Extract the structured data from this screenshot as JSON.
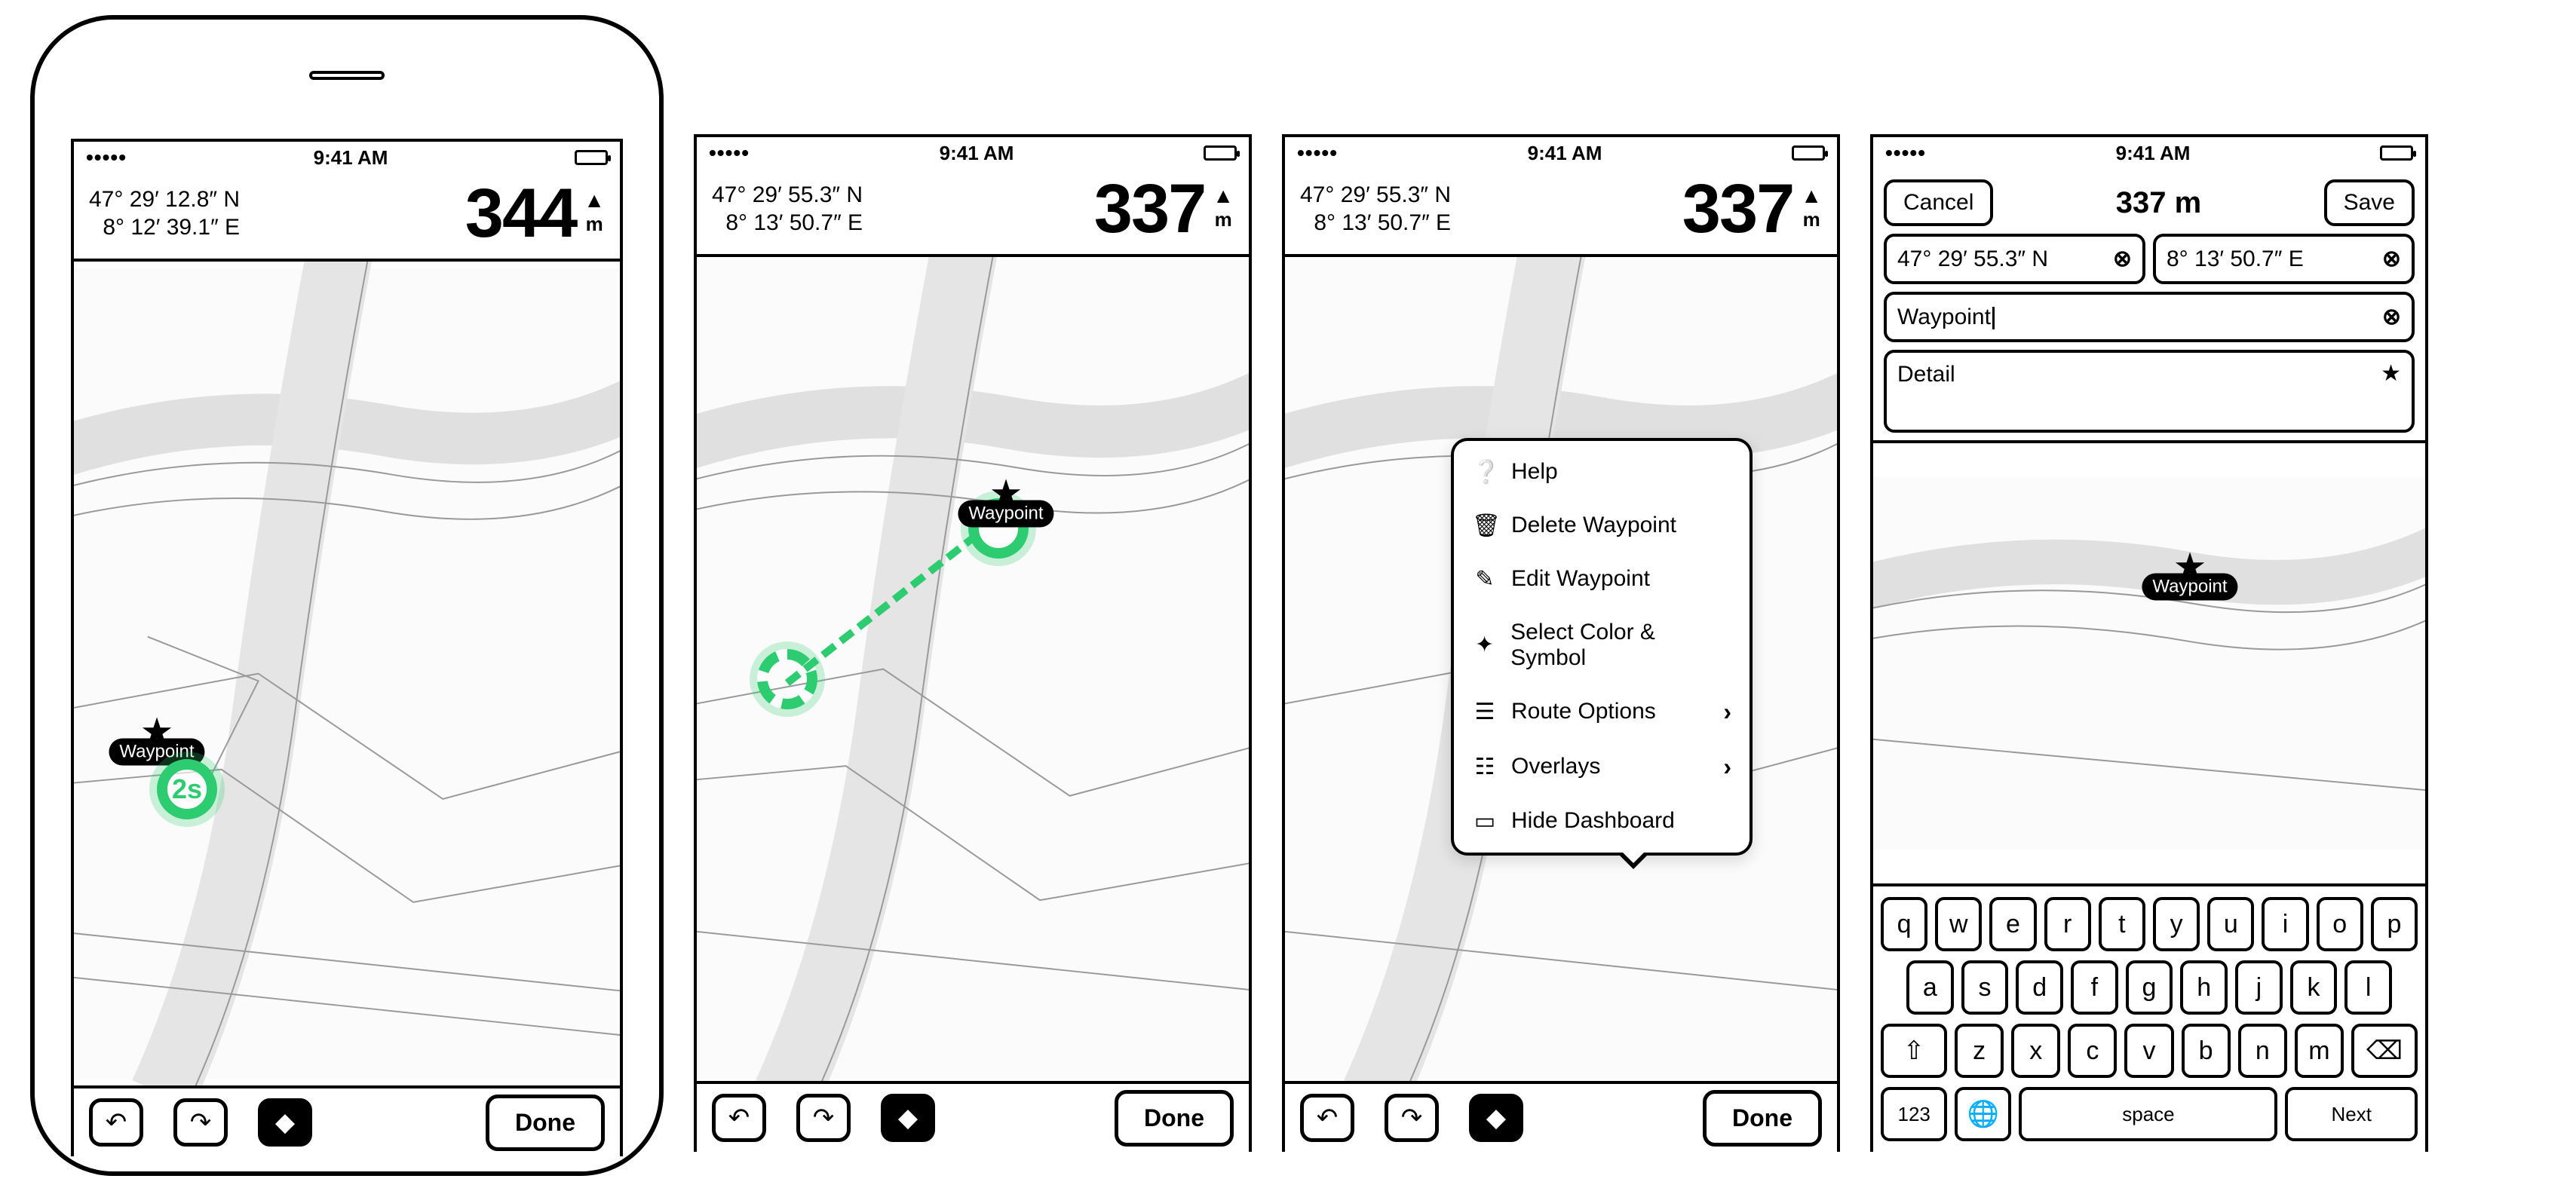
{
  "status": {
    "dots": "•••••",
    "time": "9:41 AM"
  },
  "frames": [
    {
      "coords": {
        "lat": "47° 29′ 12.8″ N",
        "lon": "8° 12′ 39.1″ E"
      },
      "elevation": {
        "value": "344",
        "unit": "m"
      },
      "waypoint_label": "Waypoint",
      "hold_timer": "2s",
      "done": "Done"
    },
    {
      "coords": {
        "lat": "47° 29′ 55.3″ N",
        "lon": "8° 13′ 50.7″ E"
      },
      "elevation": {
        "value": "337",
        "unit": "m"
      },
      "waypoint_label": "Waypoint",
      "done": "Done"
    },
    {
      "coords": {
        "lat": "47° 29′ 55.3″ N",
        "lon": "8° 13′ 50.7″ E"
      },
      "elevation": {
        "value": "337",
        "unit": "m"
      },
      "menu": [
        {
          "label": "Help",
          "icon": "?"
        },
        {
          "label": "Delete Waypoint",
          "icon": "trash"
        },
        {
          "label": "Edit Waypoint",
          "icon": "edit"
        },
        {
          "label": "Select Color & Symbol",
          "icon": "brush"
        },
        {
          "label": "Route Options",
          "icon": "sliders",
          "chevron": true
        },
        {
          "label": "Overlays",
          "icon": "layers",
          "chevron": true
        },
        {
          "label": "Hide Dashboard",
          "icon": "panel"
        }
      ],
      "done": "Done"
    },
    {
      "edit": {
        "cancel": "Cancel",
        "save": "Save",
        "title": "337 m",
        "lat": "47° 29′ 55.3″ N",
        "lon": "8° 13′ 50.7″ E",
        "name": "Waypoint",
        "detail_placeholder": "Detail"
      },
      "waypoint_label": "Waypoint",
      "keyboard": {
        "row1": [
          "q",
          "w",
          "e",
          "r",
          "t",
          "y",
          "u",
          "i",
          "o",
          "p"
        ],
        "row2": [
          "a",
          "s",
          "d",
          "f",
          "g",
          "h",
          "j",
          "k",
          "l"
        ],
        "row3": [
          "z",
          "x",
          "c",
          "v",
          "b",
          "n",
          "m"
        ],
        "shift": "⇧",
        "backspace": "⌫",
        "numbers": "123",
        "globe": "🌐",
        "space": "space",
        "next": "Next"
      }
    }
  ]
}
